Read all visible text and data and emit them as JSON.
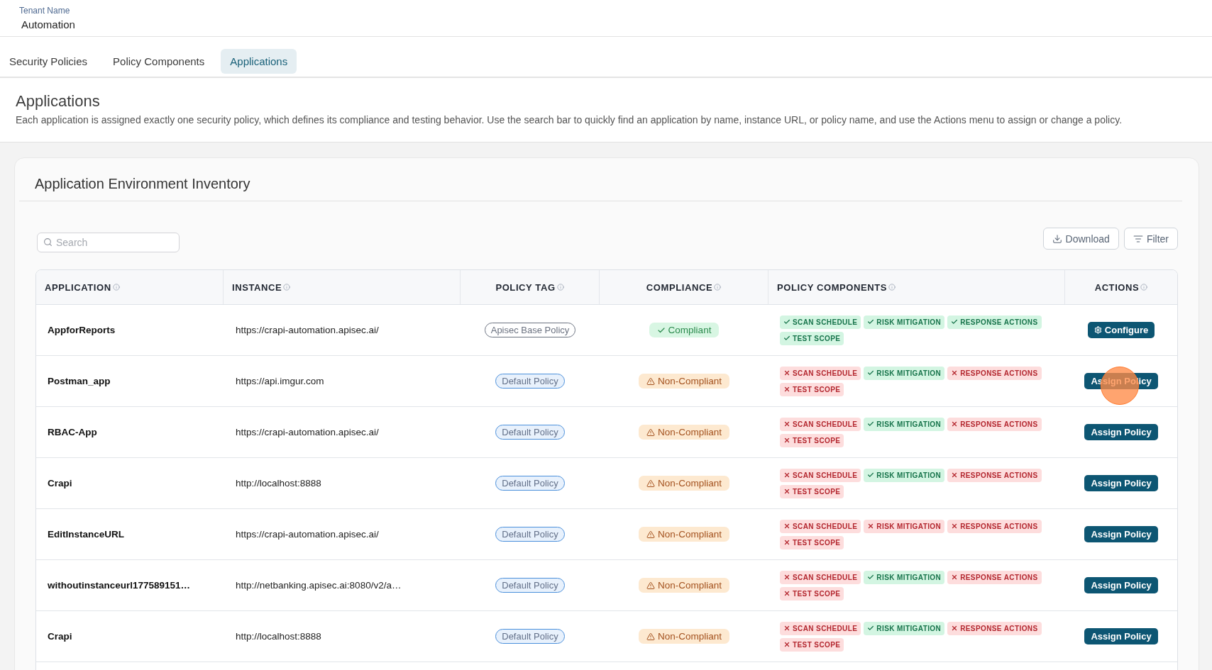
{
  "header": {
    "label": "Tenant Name",
    "value": "Automation"
  },
  "tabs": [
    {
      "label": "Security Policies",
      "selected": false
    },
    {
      "label": "Policy Components",
      "selected": false
    },
    {
      "label": "Applications",
      "selected": true
    }
  ],
  "intro": {
    "title": "Applications",
    "description": "Each application is assigned exactly one security policy, which defines its compliance and testing behavior. Use the search bar to quickly find an application by name, instance URL, or policy name, and use the Actions menu to assign or change a policy."
  },
  "inventory": {
    "title": "Application Environment Inventory",
    "search": {
      "placeholder": "Search"
    },
    "buttons": [
      {
        "label": "Download",
        "kind": "download"
      },
      {
        "label": "Filter",
        "kind": "filter"
      }
    ],
    "columns": [
      "APPLICATION",
      "INSTANCE",
      "POLICY TAG",
      "COMPLIANCE",
      "POLICY COMPONENTS",
      "ACTIONS"
    ],
    "rows": [
      {
        "application": "AppforReports",
        "instance": "https://crapi-automation.apisec.ai/",
        "policy_tag": {
          "label": "Apisec Base Policy",
          "kind": "base"
        },
        "compliance": {
          "label": "Compliant",
          "compliant": true
        },
        "components": [
          {
            "label": "SCAN SCHEDULE",
            "passed": true
          },
          {
            "label": "RISK MITIGATION",
            "passed": true
          },
          {
            "label": "RESPONSE ACTIONS",
            "passed": true
          },
          {
            "label": "TEST SCOPE",
            "passed": true
          }
        ],
        "action": {
          "label": "Configure",
          "kind": "configure"
        }
      },
      {
        "application": "Postman_app",
        "instance": "https://api.imgur.com",
        "policy_tag": {
          "label": "Default Policy",
          "kind": "default"
        },
        "compliance": {
          "label": "Non-Compliant",
          "compliant": false
        },
        "components": [
          {
            "label": "SCAN SCHEDULE",
            "passed": false
          },
          {
            "label": "RISK MITIGATION",
            "passed": true
          },
          {
            "label": "RESPONSE ACTIONS",
            "passed": false
          },
          {
            "label": "TEST SCOPE",
            "passed": false
          }
        ],
        "action": {
          "label": "Assign Policy",
          "kind": "assign",
          "click_marker": true
        }
      },
      {
        "application": "RBAC-App",
        "instance": "https://crapi-automation.apisec.ai/",
        "policy_tag": {
          "label": "Default Policy",
          "kind": "default"
        },
        "compliance": {
          "label": "Non-Compliant",
          "compliant": false
        },
        "components": [
          {
            "label": "SCAN SCHEDULE",
            "passed": false
          },
          {
            "label": "RISK MITIGATION",
            "passed": true
          },
          {
            "label": "RESPONSE ACTIONS",
            "passed": false
          },
          {
            "label": "TEST SCOPE",
            "passed": false
          }
        ],
        "action": {
          "label": "Assign Policy",
          "kind": "assign"
        }
      },
      {
        "application": "Crapi",
        "instance": "http://localhost:8888",
        "policy_tag": {
          "label": "Default Policy",
          "kind": "default"
        },
        "compliance": {
          "label": "Non-Compliant",
          "compliant": false
        },
        "components": [
          {
            "label": "SCAN SCHEDULE",
            "passed": false
          },
          {
            "label": "RISK MITIGATION",
            "passed": true
          },
          {
            "label": "RESPONSE ACTIONS",
            "passed": false
          },
          {
            "label": "TEST SCOPE",
            "passed": false
          }
        ],
        "action": {
          "label": "Assign Policy",
          "kind": "assign"
        }
      },
      {
        "application": "EditInstanceURL",
        "instance": "https://crapi-automation.apisec.ai/",
        "policy_tag": {
          "label": "Default Policy",
          "kind": "default"
        },
        "compliance": {
          "label": "Non-Compliant",
          "compliant": false
        },
        "components": [
          {
            "label": "SCAN SCHEDULE",
            "passed": false
          },
          {
            "label": "RISK MITIGATION",
            "passed": false
          },
          {
            "label": "RESPONSE ACTIONS",
            "passed": false
          },
          {
            "label": "TEST SCOPE",
            "passed": false
          }
        ],
        "action": {
          "label": "Assign Policy",
          "kind": "assign"
        }
      },
      {
        "application": "withoutinstanceurl177589151…",
        "instance": "http://netbanking.apisec.ai:8080/v2/a…",
        "policy_tag": {
          "label": "Default Policy",
          "kind": "default"
        },
        "compliance": {
          "label": "Non-Compliant",
          "compliant": false
        },
        "components": [
          {
            "label": "SCAN SCHEDULE",
            "passed": false
          },
          {
            "label": "RISK MITIGATION",
            "passed": true
          },
          {
            "label": "RESPONSE ACTIONS",
            "passed": false
          },
          {
            "label": "TEST SCOPE",
            "passed": false
          }
        ],
        "action": {
          "label": "Assign Policy",
          "kind": "assign"
        }
      },
      {
        "application": "Crapi",
        "instance": "http://localhost:8888",
        "policy_tag": {
          "label": "Default Policy",
          "kind": "default"
        },
        "compliance": {
          "label": "Non-Compliant",
          "compliant": false
        },
        "components": [
          {
            "label": "SCAN SCHEDULE",
            "passed": false
          },
          {
            "label": "RISK MITIGATION",
            "passed": true
          },
          {
            "label": "RESPONSE ACTIONS",
            "passed": false
          },
          {
            "label": "TEST SCOPE",
            "passed": false
          }
        ],
        "action": {
          "label": "Assign Policy",
          "kind": "assign"
        }
      }
    ]
  }
}
